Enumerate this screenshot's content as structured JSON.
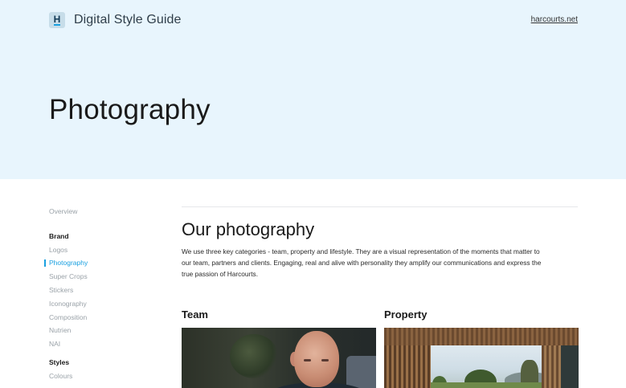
{
  "header": {
    "logo_letter": "H",
    "title": "Digital Style Guide",
    "site_link": "harcourts.net"
  },
  "hero": {
    "page_title": "Photography"
  },
  "sidebar": {
    "overview": "Overview",
    "groups": [
      {
        "heading": "Brand",
        "items": [
          "Logos",
          "Photography",
          "Super Crops",
          "Stickers",
          "Iconography",
          "Composition",
          "Nutrien",
          "NAI"
        ]
      },
      {
        "heading": "Styles",
        "items": [
          "Colours"
        ]
      }
    ],
    "active_item": "Photography"
  },
  "main": {
    "section_title": "Our photography",
    "intro": "We use three key categories - team, property and lifestyle. They are a visual representation of the moments that matter to our team, partners and clients. Engaging, real and alive with personality they amplify our communications and express the true passion of Harcourts.",
    "categories": [
      {
        "label": "Team"
      },
      {
        "label": "Property"
      }
    ]
  },
  "colors": {
    "hero_bg": "#e8f5fd",
    "accent": "#1aa0e0",
    "nav_muted": "#9aa2a8"
  }
}
